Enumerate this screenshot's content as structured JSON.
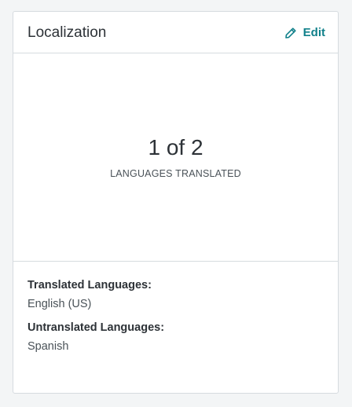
{
  "card": {
    "title": "Localization",
    "edit_label": "Edit",
    "edit_icon": "pencil-icon",
    "accent_color": "#10808a"
  },
  "stat": {
    "value": "1 of 2",
    "label": "LANGUAGES TRANSLATED"
  },
  "details": {
    "translated_label": "Translated Languages:",
    "translated_value": "English (US)",
    "untranslated_label": "Untranslated Languages:",
    "untranslated_value": "Spanish"
  }
}
